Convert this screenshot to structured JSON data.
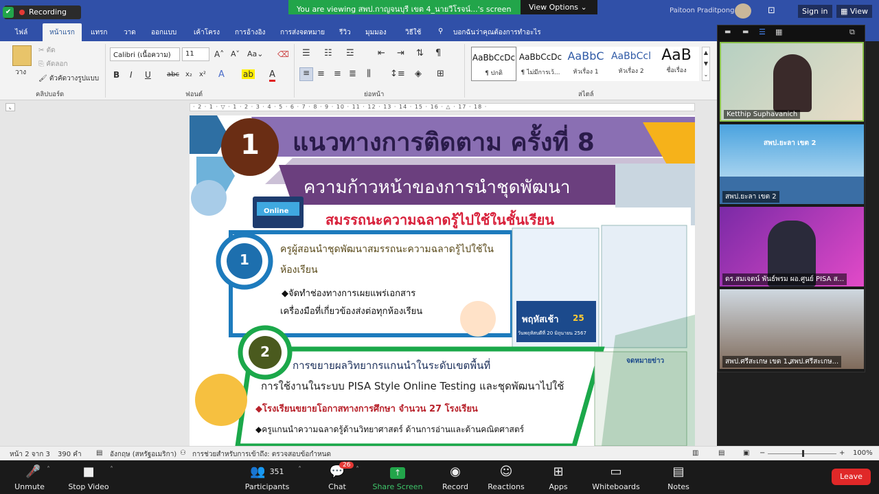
{
  "zoom_banner": {
    "viewing_text": "You are viewing สพป.กาญจนบุรี เขต 4_นายวีโรจน์...'s screen",
    "view_options": "View Options"
  },
  "recording": {
    "label": "Recording"
  },
  "titlebar": {
    "user": "Paitoon Praditpong",
    "sign_in": "Sign in",
    "view": "View"
  },
  "ribbon_tabs": [
    "ไฟล์",
    "หน้าแรก",
    "แทรก",
    "วาด",
    "ออกแบบ",
    "เค้าโครง",
    "การอ้างอิง",
    "การส่งจดหมาย",
    "รีวิว",
    "มุมมอง",
    "วิธีใช้"
  ],
  "tell_me": "บอกฉันว่าคุณต้องการทำอะไร",
  "clipboard": {
    "paste": "วาง",
    "cut": "ตัด",
    "copy": "คัดลอก",
    "format_painter": "ตัวคัดวางรูปแบบ",
    "group": "คลิปบอร์ด"
  },
  "font": {
    "name": "Calibri (เนื้อความ)",
    "size": "11",
    "group": "ฟอนต์"
  },
  "paragraph": {
    "group": "ย่อหน้า"
  },
  "styles": {
    "group": "สไตล์",
    "items": [
      {
        "preview": "AaBbCcDc",
        "name": "¶ ปกติ"
      },
      {
        "preview": "AaBbCcDc",
        "name": "¶ ไม่มีการเว้..."
      },
      {
        "preview": "AaBbC",
        "name": "หัวเรื่อง 1"
      },
      {
        "preview": "AaBbCcl",
        "name": "หัวเรื่อง 2"
      },
      {
        "preview": "AaB",
        "name": "ชื่อเรื่อง"
      }
    ]
  },
  "ruler_text": "· 2 · 1 · ▽ · 1 · 2 · 3 · 4 · 5 · 6 · 7 · 8 · 9 · 10 · 11 · 12 · 13 · 14 · 15 · 16 · △ · 17 · 18 ·",
  "slide": {
    "number": "1",
    "title": "แนวทางการติดตาม ครั้งที่ 8",
    "subtitle": "ความก้าวหน้าของการนำชุดพัฒนา",
    "subtitle2": "สมรรถนะความฉลาดรู้ไปใช้ในชั้นเรียน",
    "online_label": "Online",
    "item1_num": "1",
    "item1_head": "ครูผู้สอนนำชุดพัฒนาสมรรถนะความฉลาดรู้ไปใช้ใน",
    "item1_head2": "ห้องเรียน",
    "item1_b1": "◆จัดทำช่องทางการเผยแพร่เอกสาร",
    "item1_b2": "เครื่องมือที่เกี่ยวข้องส่งต่อทุกห้องเรียน",
    "item2_num": "2",
    "item2_head": "การขยายผลวิทยากรแกนนำในระดับเขตพื้นที่",
    "item2_sub": "การใช้งานในระบบ PISA Style Online Testing และชุดพัฒนาไปใช้",
    "item2_b1": "◆โรงเรียนขยายโอกาสทางการศึกษา จำนวน 27 โรงเรียน",
    "item2_b2": "◆ครูแกนนำความฉลาดรู้ด้านวิทยาศาสตร์ ด้านการอ่านและด้านคณิตศาสตร์",
    "poster_text1": "พฤหัสเช้า",
    "poster_text2": "25",
    "poster_text3": "วันพฤหัสบดีที่ 20 มิถุนายน 2567",
    "poster2_text": "จดหมายข่าว"
  },
  "statusbar": {
    "page": "หน้า 2 จาก 3",
    "words": "390 คำ",
    "lang": "อังกฤษ (สหรัฐอเมริกา)",
    "accessibility": "การช่วยสำหรับการเข้าถึง: ตรวจสอบข้อกำหนด",
    "zoom": "100%"
  },
  "participants_videos": [
    {
      "name": "Ketthip Suphavanich"
    },
    {
      "name": "สพป.ยะลา เขต 2"
    },
    {
      "name": "ดร.สมเจตน์ พันธ์พรม ผอ.ศูนย์ PISA ส..."
    },
    {
      "name": "สพป.ศรีสะเกษ เขต 1 สพป.ศรีสะเกษ..."
    }
  ],
  "video_overlay_text": "สพป.ยะลา เขต 2",
  "zoom_toolbar": {
    "unmute": "Unmute",
    "stop_video": "Stop Video",
    "participants": "Participants",
    "participants_count": "351",
    "chat": "Chat",
    "chat_badge": "26",
    "share_screen": "Share Screen",
    "record": "Record",
    "reactions": "Reactions",
    "apps": "Apps",
    "whiteboards": "Whiteboards",
    "notes": "Notes",
    "leave": "Leave"
  },
  "colors": {
    "word_blue": "#3050a8",
    "zoom_green": "#22a54a",
    "leave_red": "#e02828",
    "title_purple": "#8a6fb3"
  }
}
